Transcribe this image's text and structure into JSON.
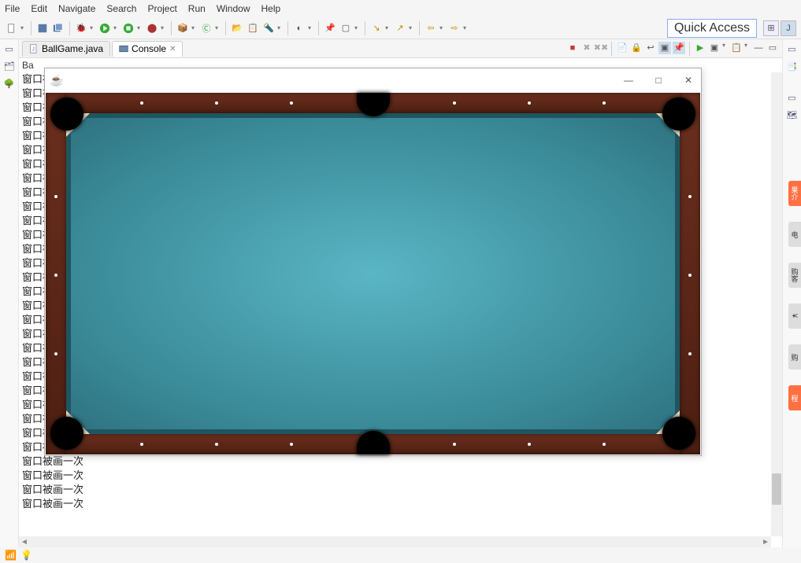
{
  "menu": [
    "File",
    "Edit",
    "Navigate",
    "Search",
    "Project",
    "Run",
    "Window",
    "Help"
  ],
  "quick_access": "Quick Access",
  "tabs": {
    "file_tab": "BallGame.java",
    "console_tab": "Console"
  },
  "console_header_label": "Ba",
  "console_lines": [
    "窗口被画一次",
    "窗口被画一次",
    "窗口被画一次",
    "窗口被画一次",
    "窗口被画一次",
    "窗口被画一次",
    "窗口被画一次",
    "窗口被画一次",
    "窗口被画一次",
    "窗口被画一次",
    "窗口被画一次",
    "窗口被画一次",
    "窗口被画一次",
    "窗口被画一次",
    "窗口被画一次",
    "窗口被画一次",
    "窗口被画一次",
    "窗口被画一次",
    "窗口被画一次",
    "窗口被画一次",
    "窗口被画一次",
    "窗口被画一次",
    "窗口被画一次",
    "窗口被画一次",
    "窗口被画一次",
    "窗口被画一次",
    "窗口被画一次",
    "窗口被画一次",
    "窗口被画一次",
    "窗口被画一次",
    "窗口被画一次"
  ],
  "java_window": {
    "title": "",
    "min": "—",
    "max": "□",
    "close": "✕"
  },
  "side_tabs": [
    "果介",
    "电",
    "购客",
    "¥",
    "购",
    "程"
  ]
}
